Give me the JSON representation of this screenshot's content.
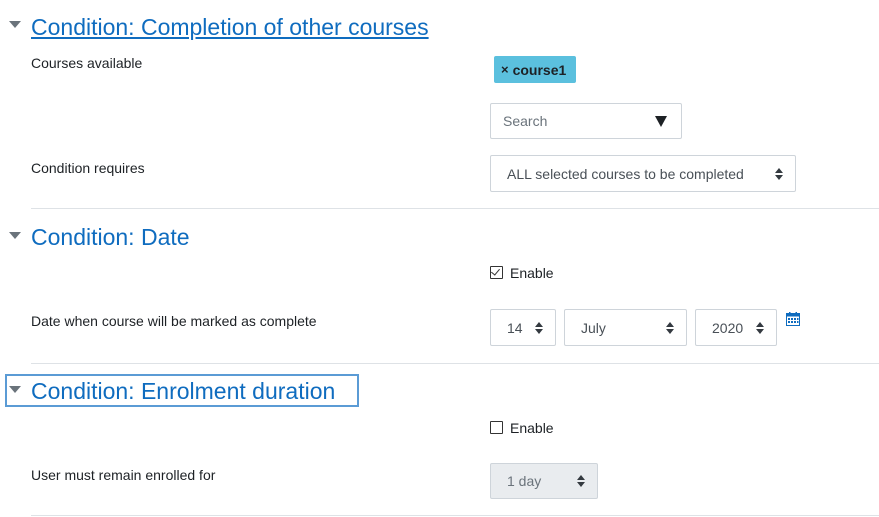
{
  "sections": {
    "completion_courses": {
      "title": "Condition: Completion of other courses",
      "courses_available_label": "Courses available",
      "selected_course_tag": "course1",
      "tag_remove_glyph": "×",
      "search_placeholder": "Search",
      "condition_requires_label": "Condition requires",
      "condition_requires_value": "ALL selected courses to be completed"
    },
    "date": {
      "title": "Condition: Date",
      "enable_label": "Enable",
      "enable_checked": true,
      "date_label": "Date when course will be marked as complete",
      "day": "14",
      "month": "July",
      "year": "2020",
      "calendar_icon": "calendar-icon"
    },
    "enrolment_duration": {
      "title": "Condition: Enrolment duration",
      "enable_label": "Enable",
      "enable_checked": false,
      "duration_label": "User must remain enrolled for",
      "duration_value": "1 day"
    }
  },
  "colors": {
    "link_blue": "#0f6cbf",
    "tag_bg": "#5bc0de",
    "focus_outline": "#5b9bd5",
    "divider": "#dee2e6"
  }
}
